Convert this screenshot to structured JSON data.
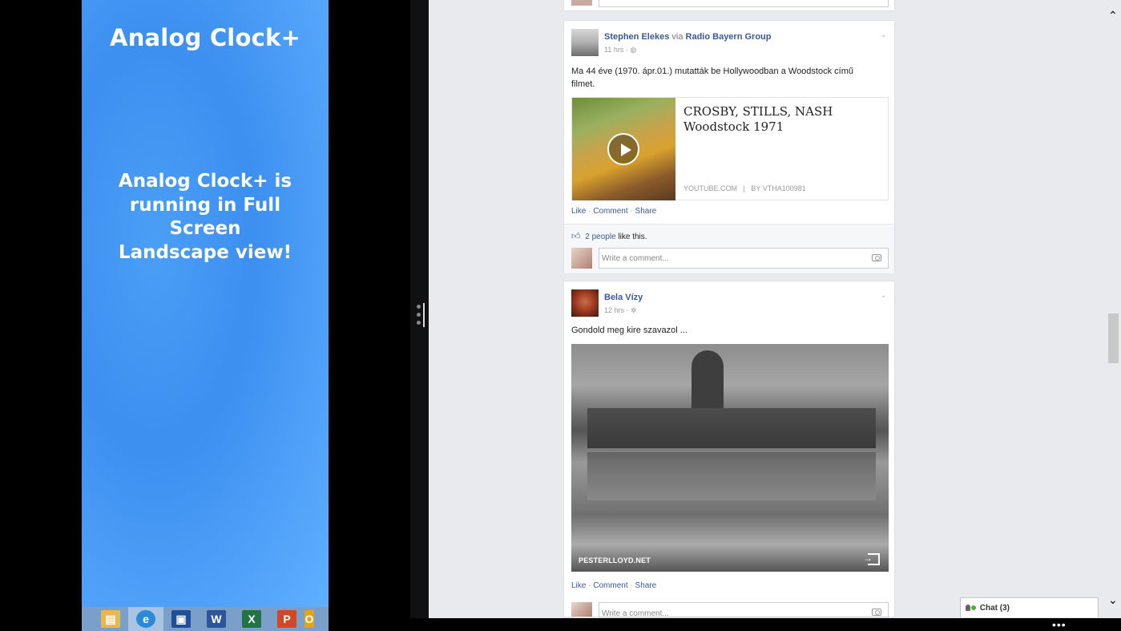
{
  "left_app": {
    "title": "Analog Clock+",
    "message": "Analog Clock+ is running in Full Screen Landscape view!"
  },
  "taskbar": {
    "items": [
      {
        "name": "file-explorer-icon",
        "glyph": "▤",
        "color": "#e8b84a"
      },
      {
        "name": "internet-explorer-icon",
        "glyph": "e",
        "color": "#2a8ad8"
      },
      {
        "name": "save-icon",
        "glyph": "▣",
        "color": "#1f4e9c"
      },
      {
        "name": "word-icon",
        "glyph": "W",
        "color": "#2b579a"
      },
      {
        "name": "excel-icon",
        "glyph": "X",
        "color": "#217346"
      },
      {
        "name": "powerpoint-icon",
        "glyph": "P",
        "color": "#d24726"
      },
      {
        "name": "outlook-icon",
        "glyph": "O",
        "color": "#e8a21a"
      }
    ]
  },
  "feed": {
    "post1": {
      "author": "Stephen Elekes",
      "via": "via",
      "group": "Radio Bayern Group",
      "time": "11 hrs ·",
      "text_line1": "Ma 44 éve (1970. ápr.01.) mutatták be Hollywoodban a Woodstock című",
      "text_line2": "filmet.",
      "share_title_line1": "CROSBY, STILLS, NASH",
      "share_title_line2": "Woodstock 1971",
      "share_source": "YOUTUBE.COM",
      "share_sep": "|",
      "share_by": "BY VTHA100981",
      "like": "Like",
      "comment": "Comment",
      "share": "Share",
      "dot": "·",
      "likes_count": "2 people",
      "likes_suffix": "like this.",
      "comment_placeholder": "Write a comment..."
    },
    "post2": {
      "author": "Bela Vízy",
      "time": "12 hrs ·",
      "text": "Gondold meg kire szavazol ...",
      "photo_caption": "PESTERLLOYD.NET",
      "like": "Like",
      "comment": "Comment",
      "share": "Share",
      "dot": "·",
      "comment_placeholder": "Write a comment..."
    }
  },
  "chat": {
    "label": "Chat (3)"
  },
  "app_bar": {
    "more": "•••"
  }
}
